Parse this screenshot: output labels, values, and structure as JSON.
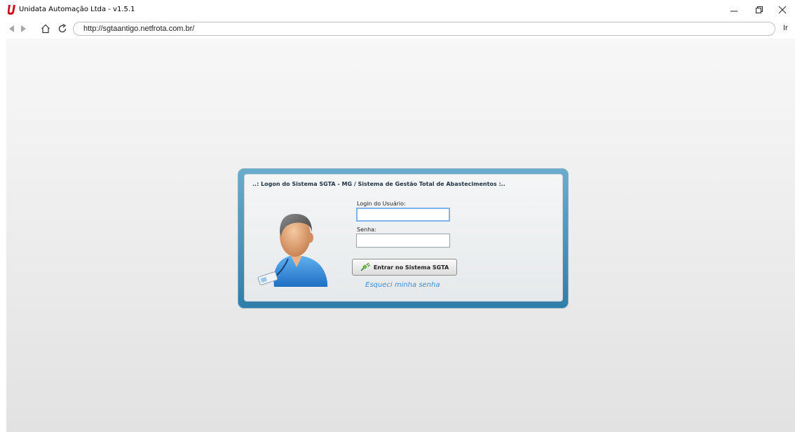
{
  "window": {
    "title": "Unidata Automação Ltda - v1.5.1",
    "logo_letter": "U",
    "brand_color": "#d10a1a"
  },
  "browser": {
    "url": "http://sgtaantigo.netfrota.com.br/",
    "go_label": "Ir"
  },
  "login": {
    "header": "..: Logon do Sistema SGTA - MG /  Sistema de Gestão Total de Abastecimentos :..",
    "user_label": "Login do Usuário:",
    "user_value": "",
    "password_label": "Senha:",
    "password_value": "",
    "enter_button": "Entrar no Sistema SGTA",
    "forgot_link": "Esqueci minha senha"
  },
  "colors": {
    "panel_frame": "#3b8bb8",
    "link": "#3b8fd6"
  },
  "icons": {
    "user_avatar": "user-avatar-icon",
    "enter_button": "plug-connect-icon"
  }
}
